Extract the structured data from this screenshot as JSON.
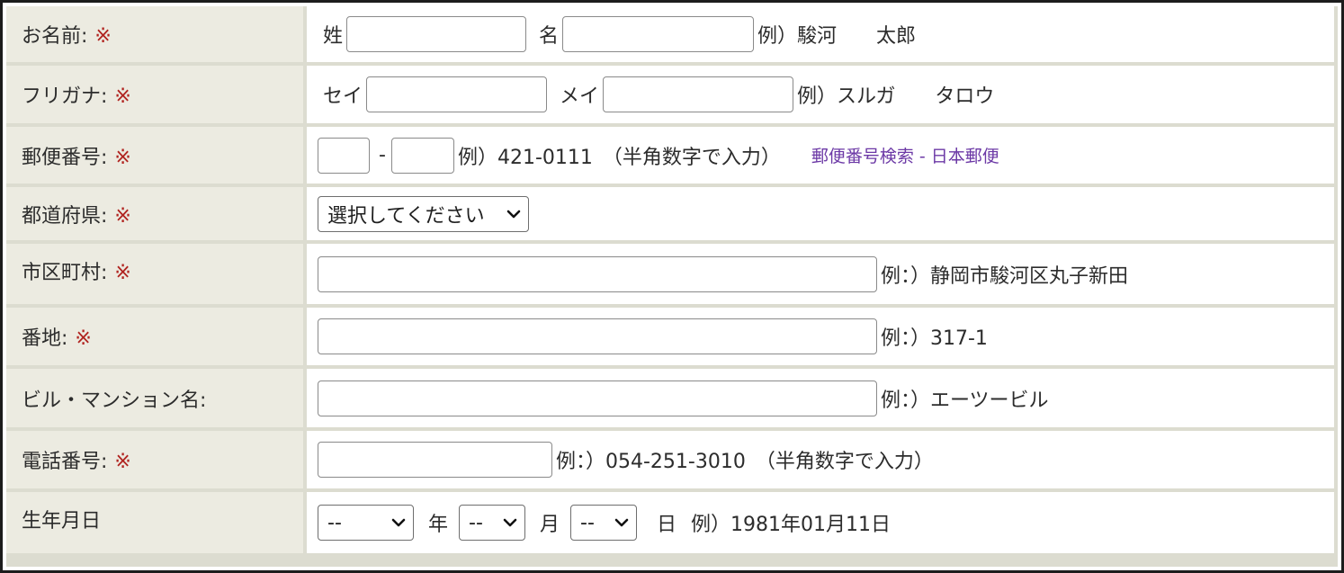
{
  "required_mark": "※",
  "colors": {
    "label_bg": "#ecebe1",
    "border": "#dcdcd0",
    "required": "#b0231f",
    "link": "#6c39a6"
  },
  "rows": {
    "name": {
      "label": "お名前:",
      "sei_label": "姓",
      "mei_label": "名",
      "sei_value": "",
      "mei_value": "",
      "example": "例）駿河　　太郎"
    },
    "furigana": {
      "label": "フリガナ:",
      "sei_label": "セイ",
      "mei_label": "メイ",
      "sei_value": "",
      "mei_value": "",
      "example": "例）スルガ　　タロウ"
    },
    "postal": {
      "label": "郵便番号:",
      "part1_value": "",
      "dash": "-",
      "part2_value": "",
      "example": "例）421-0111　（半角数字で入力）",
      "lookup_link": "郵便番号検索 - 日本郵便"
    },
    "prefecture": {
      "label": "都道府県:",
      "selected": "選択してください"
    },
    "city": {
      "label": "市区町村:",
      "value": "",
      "example": "例：）静岡市駿河区丸子新田"
    },
    "address": {
      "label": "番地:",
      "value": "",
      "example": "例：）317-1"
    },
    "building": {
      "label": "ビル・マンション名:",
      "value": "",
      "example": "例：）エーツービル"
    },
    "phone": {
      "label": "電話番号:",
      "value": "",
      "example": "例：）054-251-3010　（半角数字で入力）"
    },
    "birthday": {
      "label": "生年月日",
      "year_selected": "--",
      "year_unit": "年",
      "month_selected": "--",
      "month_unit": "月",
      "day_selected": "--",
      "day_unit": "日",
      "example": "例）1981年01月11日"
    }
  }
}
